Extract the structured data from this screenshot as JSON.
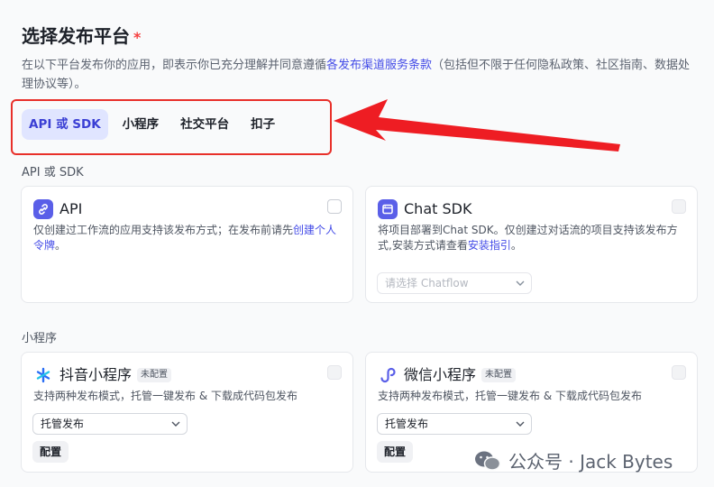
{
  "header": {
    "title": "选择发布平台",
    "required_mark": "*",
    "desc_prefix": "在以下平台发布你的应用，即表示你已充分理解并同意遵循",
    "desc_link": "各发布渠道服务条款",
    "desc_suffix": "（包括但不限于任何隐私政策、社区指南、数据处理协议等）。"
  },
  "tabs": [
    {
      "label": "API 或 SDK",
      "active": true
    },
    {
      "label": "小程序",
      "active": false
    },
    {
      "label": "社交平台",
      "active": false
    },
    {
      "label": "扣子",
      "active": false
    }
  ],
  "sections": {
    "api_sdk": {
      "label": "API 或 SDK",
      "cards": {
        "api": {
          "icon": "link-icon",
          "title": "API",
          "desc_prefix": "仅创建过工作流的应用支持该发布方式；在发布前请先",
          "desc_link": "创建个人令牌",
          "desc_suffix": "。"
        },
        "chat_sdk": {
          "icon": "window-icon",
          "title": "Chat SDK",
          "desc_prefix": "将项目部署到Chat SDK。仅创建过对话流的项目支持该发布方式,安装方式请查看",
          "desc_link": "安装指引",
          "desc_suffix": "。",
          "select_placeholder": "请选择 Chatflow"
        }
      }
    },
    "mini_program": {
      "label": "小程序",
      "cards": {
        "douyin": {
          "icon": "douyin-icon",
          "title": "抖音小程序",
          "badge": "未配置",
          "desc": "支持两种发布模式，托管一键发布 & 下载成代码包发布",
          "select_value": "托管发布",
          "config_label": "配置"
        },
        "wechat": {
          "icon": "wechat-mini-icon",
          "title": "微信小程序",
          "badge": "未配置",
          "desc": "支持两种发布模式，托管一键发布 & 下载成代码包发布",
          "select_value": "托管发布",
          "config_label": "配置"
        }
      }
    }
  },
  "watermark": {
    "text": "公众号 · Jack Bytes",
    "icon": "wechat-logo-icon"
  },
  "colors": {
    "accent": "#444ce7",
    "highlight": "#e8302a",
    "active_tab_bg": "#e0e5ff"
  }
}
